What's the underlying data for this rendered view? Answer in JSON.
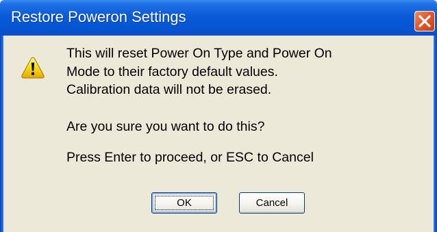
{
  "dialog": {
    "title": "Restore Poweron Settings",
    "title_icon": "close-icon",
    "warning_icon": "warning-icon",
    "message_lines": [
      "This will reset Power On Type and Power On",
      "Mode to their factory default values.",
      "Calibration data will not be erased."
    ],
    "question": "Are you sure you want to do this?",
    "instruction": "Press Enter to proceed, or ESC to Cancel",
    "buttons": {
      "ok_label": "OK",
      "cancel_label": "Cancel"
    }
  },
  "colors": {
    "titlebar": "#0654d2",
    "close_button": "#e25a2e",
    "dialog_body": "#ece9d8",
    "warning_yellow": "#f5d21a"
  }
}
